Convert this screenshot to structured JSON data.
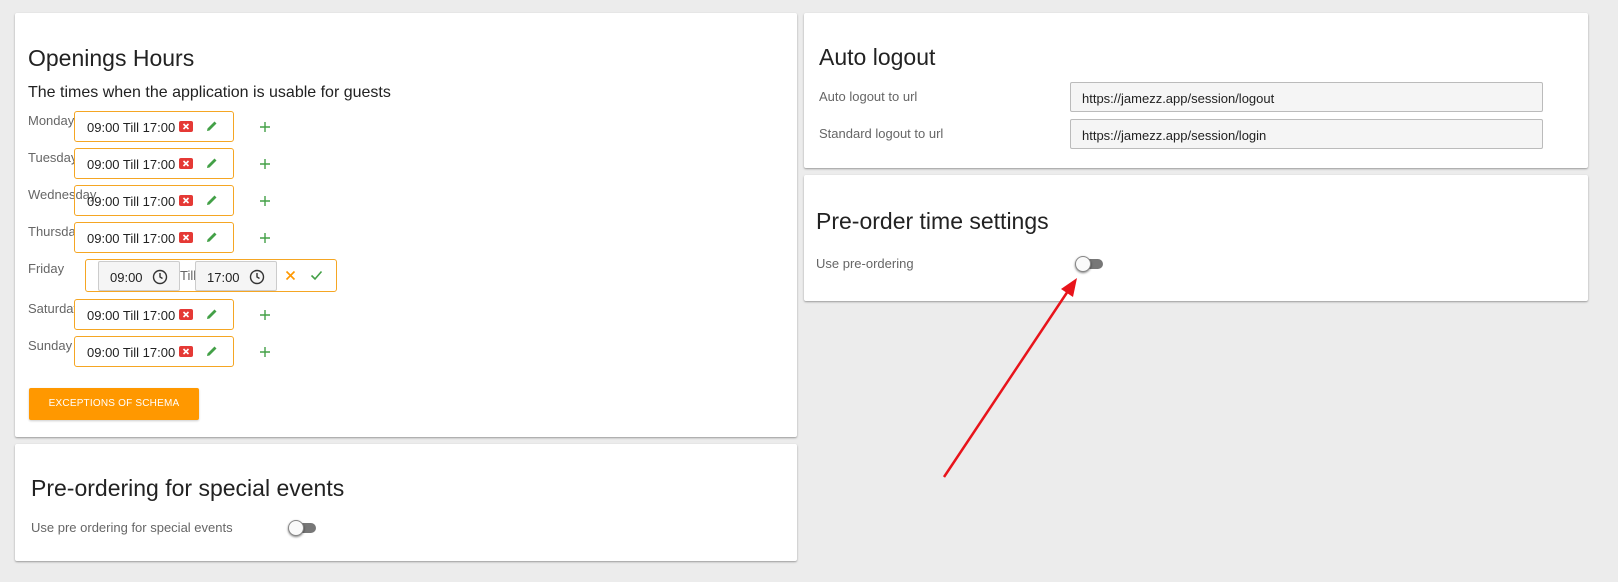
{
  "opening_hours": {
    "title": "Openings Hours",
    "subtitle": "The times when the application is usable for guests",
    "days": [
      {
        "label": "Monday",
        "slot": "09:00 Till 17:00"
      },
      {
        "label": "Tuesday",
        "slot": "09:00 Till 17:00"
      },
      {
        "label": "Wednesday",
        "slot": "09:00 Till 17:00"
      },
      {
        "label": "Thursday",
        "slot": "09:00 Till 17:00"
      },
      {
        "label": "Friday",
        "slot": ""
      },
      {
        "label": "Saturday",
        "slot": "09:00 Till 17:00"
      },
      {
        "label": "Sunday",
        "slot": "09:00 Till 17:00"
      }
    ],
    "editing": {
      "from": "09:00",
      "till_label": "Till",
      "to": "17:00"
    },
    "exceptions_button": "EXCEPTIONS OF SCHEMA"
  },
  "special_events": {
    "title": "Pre-ordering for special events",
    "toggle_label": "Use pre ordering for special events",
    "enabled": false
  },
  "auto_logout": {
    "title": "Auto logout",
    "auto_label": "Auto logout to url",
    "auto_value": "https://jamezz.app/session/logout",
    "standard_label": "Standard logout to url",
    "standard_value": "https://jamezz.app/session/login"
  },
  "preorder_time": {
    "title": "Pre-order time settings",
    "toggle_label": "Use pre-ordering",
    "enabled": false
  },
  "colors": {
    "accent": "#ff9800",
    "delete": "#e53935",
    "edit": "#43a047",
    "arrow": "#e8141b"
  },
  "icons": [
    "delete-icon",
    "edit-icon",
    "plus-icon",
    "clock-icon",
    "close-icon",
    "check-icon"
  ]
}
